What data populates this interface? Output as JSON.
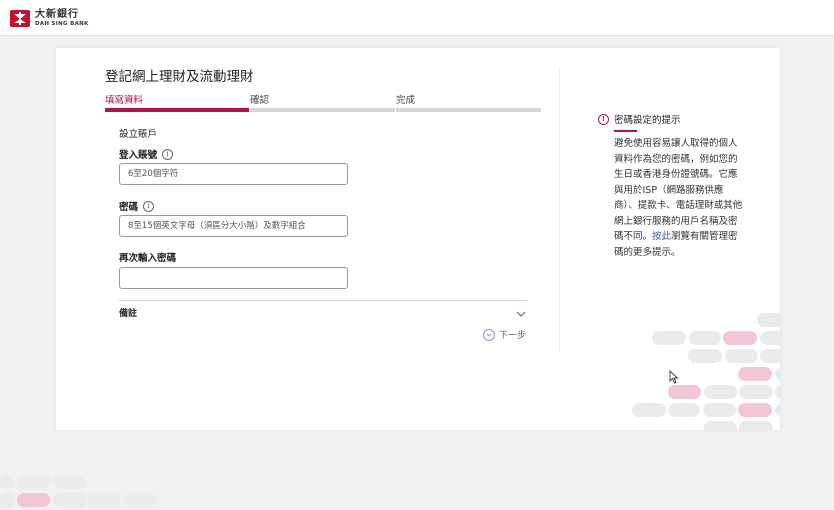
{
  "header": {
    "logo_zh": "大新銀行",
    "logo_en": "DAH SING BANK",
    "brand_color": "#c8102e"
  },
  "form": {
    "title": "登記網上理財及流動理財",
    "steps": [
      {
        "label": "填寫資料",
        "active": true
      },
      {
        "label": "確認",
        "active": false
      },
      {
        "label": "完成",
        "active": false
      }
    ],
    "section_label": "設立賬戶",
    "login_account": {
      "label": "登入賬號",
      "placeholder": "6至20個字符",
      "value": ""
    },
    "password": {
      "label": "密碼",
      "placeholder": "8至15個英文字母（須區分大小階）及數字組合",
      "value": ""
    },
    "confirm_password": {
      "label": "再次輸入密碼",
      "placeholder": "",
      "value": ""
    },
    "remarks_label": "備註",
    "next_label": "下一步",
    "accent_color": "#b5114a"
  },
  "tips": {
    "title": "密碼設定的提示",
    "body": "避免使用容易讓人取得的個人資料作為您的密碼，例如您的生日或香港身份證號碼。它應與用於ISP（網路服務供應商）、提款卡、電話理財或其他網上銀行服務的用戶名稱及密碼不同。",
    "link_text": "按此",
    "body_tail": "瀏覽有關管理密碼的更多提示。"
  }
}
